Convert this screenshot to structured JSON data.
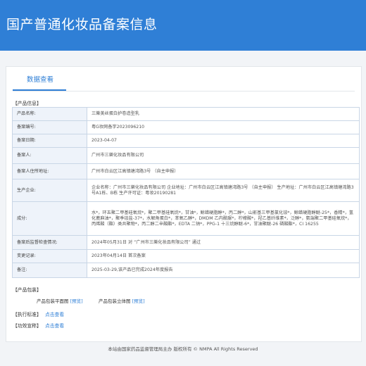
{
  "header": {
    "title": "国产普通化妆品备案信息"
  },
  "tabs": {
    "active": "数据查看"
  },
  "product_info": {
    "section_title": "【产品信息】",
    "rows": [
      {
        "label": "产品名称:",
        "value": "三樂美丝蛋白护卷造型乳"
      },
      {
        "label": "备案编号:",
        "value": "粤G妆网备字2023096210"
      },
      {
        "label": "备案日期:",
        "value": "2023-04-07"
      },
      {
        "label": "备案人:",
        "value": "广州市三樂化妆品有限公司"
      },
      {
        "label": "备案人住所地址:",
        "value": "广州市白云区江高镇塘湾路3号 （自主申报）"
      },
      {
        "label": "生产企业:",
        "value": "企业名称：广州市三樂化妆品有限公司 企业地址：广州市白云区江高镇塘湾路3号 （自主申报） 生产地址：广州市白云区江高镇塘湾路3号A1栋、B栋 生产许可证：粤妆20190281"
      },
      {
        "label": "成分:",
        "value": "水*，环五聚二甲基硅氧烷*，聚二甲基硅氧烷*，甘油*，鲸蜡硬脂醇*，丙二醇*，山嵛基三甲基氯化铵*，鲸蜡硬脂醇醚-25*，香精*，氢化蓖麻油*，聚季铵盐-37*，水解角蛋白*，苯氧乙醇*，DMDM 乙内酰脲*，柠檬酸*，羟乙基纤维素*，泛醇*，氨端聚二甲基硅氧烷*，丙烯酸（酯）类共聚物*，丙二醇二辛酸酯*，EDTA 二钠*，PPG-1 十三烷醇醚-6*，甘油聚醚-26 磷酸酯*，CI 16255"
      },
      {
        "label": "备案后监督检查情况:",
        "value": "2024年05月31日 对 “广州市三樂化妆品有限公司” 通过"
      },
      {
        "label": "变更记录:",
        "value": "2023年04月14日 首次备案"
      },
      {
        "label": "备注:",
        "value": "2025-03-29,该产品已完成2024年度报告"
      }
    ]
  },
  "package": {
    "section_title": "【产品包装】",
    "flat_label": "产品包装平面图",
    "flat_link": "[预览]",
    "solid_label": "产品包装立体图",
    "solid_link": "[预览]"
  },
  "standard": {
    "section_title": "【执行标准】",
    "link": "点击查看"
  },
  "efficacy": {
    "section_title": "【功效宣称】",
    "link": "点击查看"
  },
  "footer": {
    "text": "本站由国家药品监督管理局主办 版权所有 © NMPA All Rights Reserved"
  }
}
